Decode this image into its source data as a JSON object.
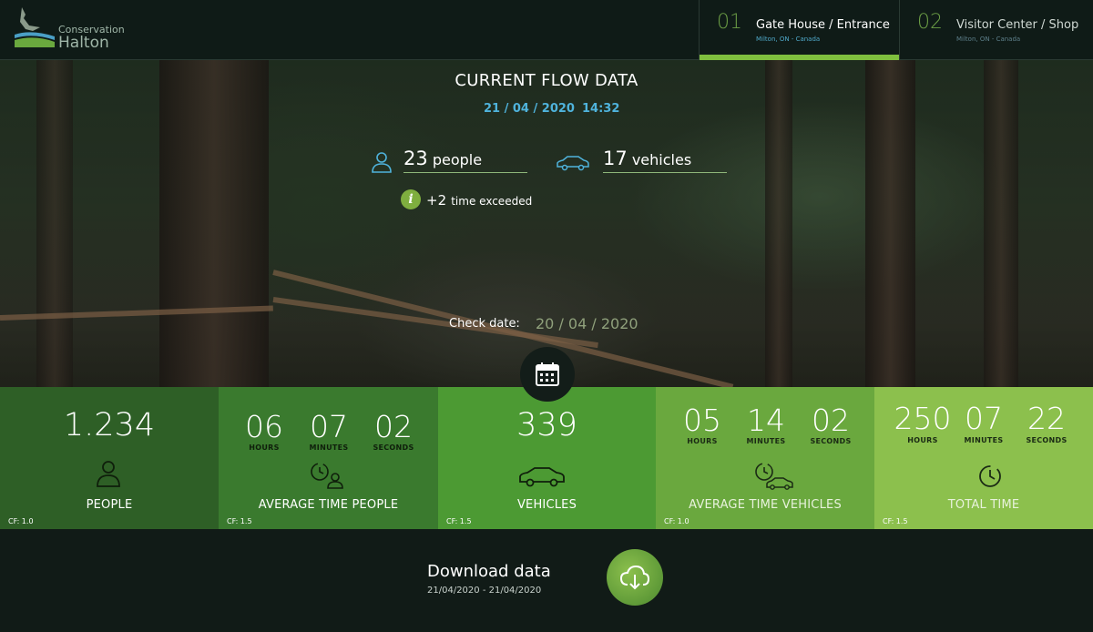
{
  "header": {
    "logo_line1": "Conservation",
    "logo_line2": "Halton",
    "tabs": [
      {
        "num": "01",
        "name": "Gate House / Entrance",
        "location": "Milton, ON - Canada",
        "active": true
      },
      {
        "num": "02",
        "name": "Visitor Center / Shop",
        "location": "Milton, ON - Canada",
        "active": false
      }
    ]
  },
  "flow": {
    "title": "CURRENT FLOW DATA",
    "date": "21 / 04 / 2020",
    "time": "14:32",
    "people_count": "23",
    "people_unit": "people",
    "vehicles_count": "17",
    "vehicles_unit": "vehicles",
    "exceeded_count": "+2",
    "exceeded_label": "time exceeded",
    "check_label": "Check date:",
    "check_value": "20 / 04 / 2020"
  },
  "tiles": {
    "people": {
      "value": "1.234",
      "label": "PEOPLE",
      "cf": "CF: 1.0"
    },
    "avg_people": {
      "hours": "06",
      "minutes": "07",
      "seconds": "02",
      "label": "AVERAGE TIME PEOPLE",
      "cf": "CF: 1.5"
    },
    "vehicles": {
      "value": "339",
      "label": "VEHICLES",
      "cf": "CF: 1.5"
    },
    "avg_vehicles": {
      "hours": "05",
      "minutes": "14",
      "seconds": "02",
      "label": "AVERAGE TIME VEHICLES",
      "cf": "CF: 1.0"
    },
    "total": {
      "hours": "250",
      "minutes": "07",
      "seconds": "22",
      "label": "TOTAL TIME",
      "cf": "CF: 1.5"
    },
    "unit_hours": "HOURS",
    "unit_minutes": "MINUTES",
    "unit_seconds": "SECONDS"
  },
  "download": {
    "title": "Download data",
    "range": "21/04/2020 - 21/04/2020"
  },
  "colors": {
    "accent": "#7fbf3e",
    "date_blue": "#4fb3dc",
    "background": "#111b17"
  }
}
